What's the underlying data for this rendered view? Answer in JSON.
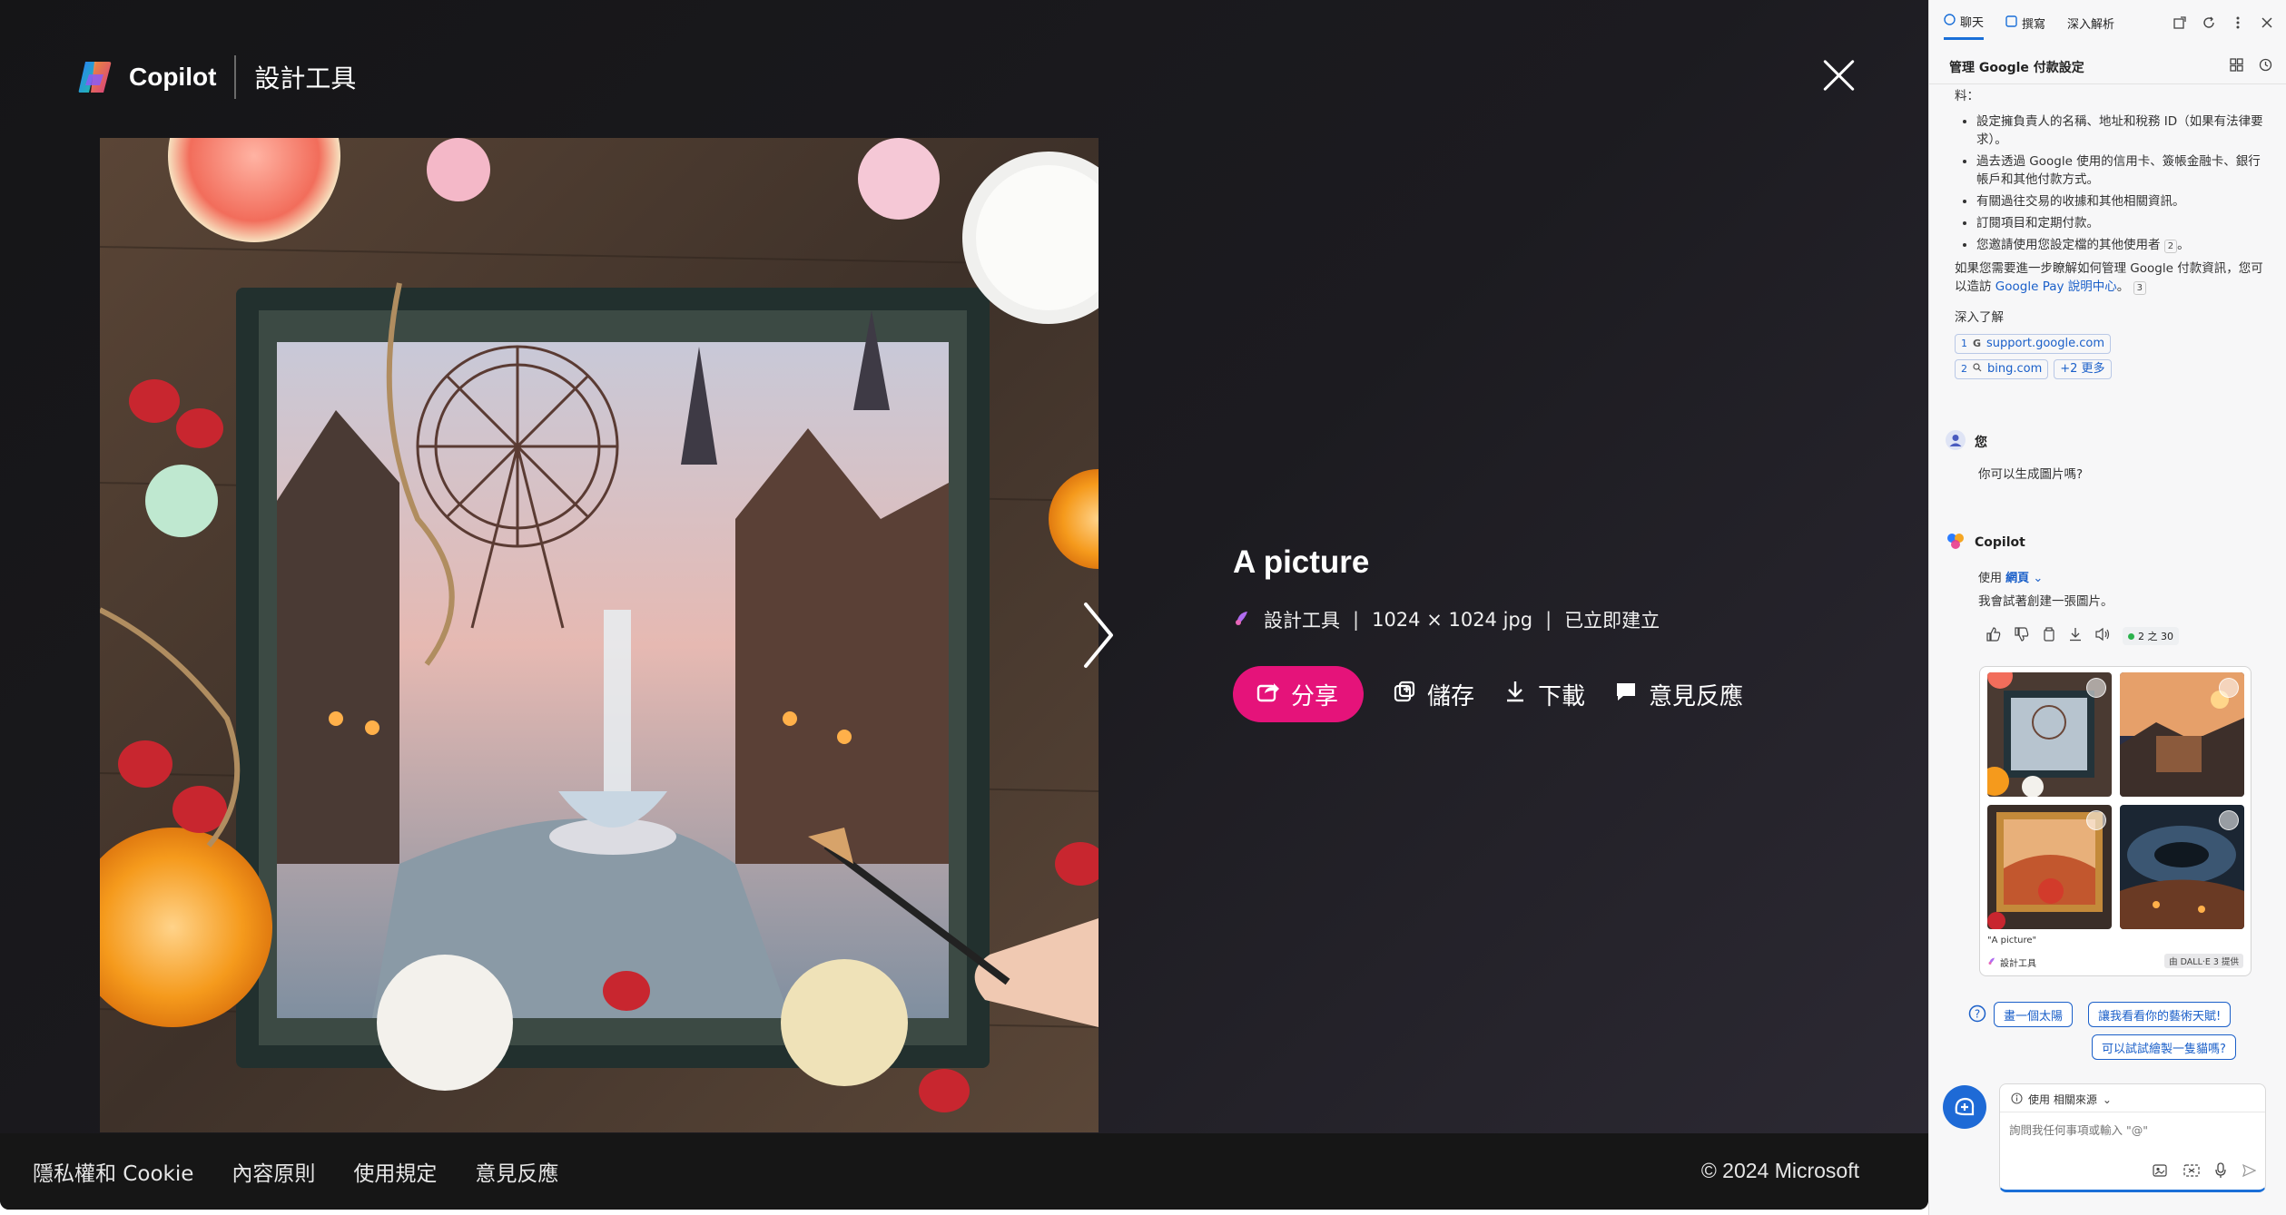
{
  "viewer": {
    "brand": "Copilot",
    "sub": "設計工具",
    "title": "A picture",
    "meta_source": "設計工具",
    "meta_size": "1024 × 1024 jpg",
    "meta_time": "已立即建立",
    "share": "分享",
    "save": "儲存",
    "download": "下載",
    "feedback": "意見反應",
    "footer_links": [
      "隱私權和 Cookie",
      "內容原則",
      "使用規定",
      "意見反應"
    ],
    "copyright": "© 2024 Microsoft"
  },
  "sidebar": {
    "tabs": [
      "聊天",
      "撰寫",
      "深入解析"
    ],
    "panel_title": "管理 Google 付款設定",
    "top_fragment": "料：",
    "bullets": [
      "設定擁負責人的名稱、地址和稅務 ID（如果有法律要求）。",
      "過去透過 Google 使用的信用卡、簽帳金融卡、銀行帳戶和其他付款方式。",
      "有關過往交易的收據和其他相關資訊。",
      "訂閱項目和定期付款。",
      "您邀請使用您設定檔的其他使用者"
    ],
    "bullet5_cite": "2",
    "para_pre": "如果您需要進一步瞭解如何管理 Google 付款資訊，您可以造訪 ",
    "para_link": "Google Pay 說明中心",
    "para_cite": "3",
    "learn_more": "深入了解",
    "chips": [
      {
        "n": "1",
        "label": "support.google.com"
      },
      {
        "n": "2",
        "label": "bing.com"
      },
      {
        "n": "",
        "label": "+2 更多"
      }
    ],
    "user_name": "您",
    "user_msg": "你可以生成圖片嗎?",
    "bot_name": "Copilot",
    "bot_use": "使用",
    "bot_web": "網頁",
    "bot_msg": "我會試著創建一張圖片。",
    "counter": "2 之 30",
    "grid_caption": "\"A picture\"",
    "grid_source": "設計工具",
    "grid_badge": "由 DALL·E 3 提供",
    "suggestions": [
      "畫一個太陽",
      "讓我看看你的藝術天賦!",
      "可以試試繪製一隻貓嗎?"
    ],
    "source_label": "使用 相關來源",
    "input_placeholder": "詢問我任何事項或輸入 \"@\""
  },
  "colors": {
    "accent_pink": "#e5137a",
    "link_blue": "#1a5fc9",
    "viewer_bg": "#1c1b20"
  }
}
